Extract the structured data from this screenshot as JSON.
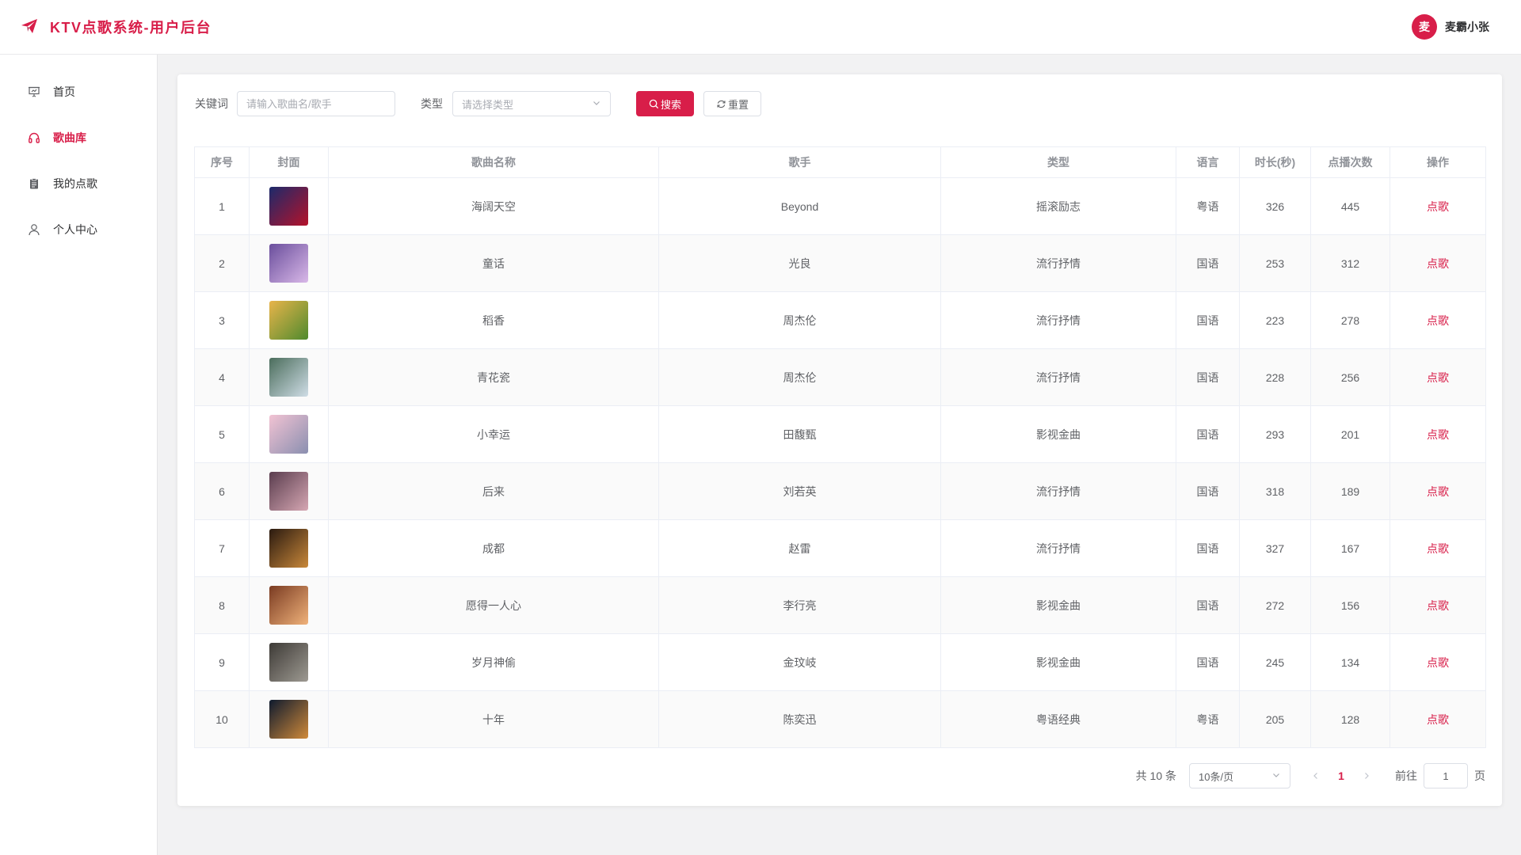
{
  "app": {
    "title": "KTV点歌系统-用户后台"
  },
  "user": {
    "avatar_text": "麦",
    "name": "麦霸小张"
  },
  "sidebar": {
    "items": [
      {
        "label": "首页",
        "icon": "presentation-icon"
      },
      {
        "label": "歌曲库",
        "icon": "headphones-icon",
        "active": true
      },
      {
        "label": "我的点歌",
        "icon": "clipboard-icon"
      },
      {
        "label": "个人中心",
        "icon": "user-icon"
      }
    ]
  },
  "search": {
    "keyword_label": "关键词",
    "keyword_placeholder": "请输入歌曲名/歌手",
    "type_label": "类型",
    "type_placeholder": "请选择类型",
    "search_button": "搜索",
    "reset_button": "重置"
  },
  "table": {
    "columns": [
      "序号",
      "封面",
      "歌曲名称",
      "歌手",
      "类型",
      "语言",
      "时长(秒)",
      "点播次数",
      "操作"
    ],
    "rows": [
      {
        "index": "1",
        "name": "海阔天空",
        "singer": "Beyond",
        "type": "摇滚励志",
        "language": "粤语",
        "duration": "326",
        "plays": "445",
        "action": "点歌",
        "cover_colors": [
          "#1c2a6b",
          "#b5122a"
        ]
      },
      {
        "index": "2",
        "name": "童话",
        "singer": "光良",
        "type": "流行抒情",
        "language": "国语",
        "duration": "253",
        "plays": "312",
        "action": "点歌",
        "cover_colors": [
          "#6a4e9c",
          "#d9b8e8"
        ]
      },
      {
        "index": "3",
        "name": "稻香",
        "singer": "周杰伦",
        "type": "流行抒情",
        "language": "国语",
        "duration": "223",
        "plays": "278",
        "action": "点歌",
        "cover_colors": [
          "#e8b44a",
          "#4f8a2e"
        ]
      },
      {
        "index": "4",
        "name": "青花瓷",
        "singer": "周杰伦",
        "type": "流行抒情",
        "language": "国语",
        "duration": "228",
        "plays": "256",
        "action": "点歌",
        "cover_colors": [
          "#4b6d5c",
          "#cfdde6"
        ]
      },
      {
        "index": "5",
        "name": "小幸运",
        "singer": "田馥甄",
        "type": "影视金曲",
        "language": "国语",
        "duration": "293",
        "plays": "201",
        "action": "点歌",
        "cover_colors": [
          "#f2c3d3",
          "#8a8fb0"
        ]
      },
      {
        "index": "6",
        "name": "后来",
        "singer": "刘若英",
        "type": "流行抒情",
        "language": "国语",
        "duration": "318",
        "plays": "189",
        "action": "点歌",
        "cover_colors": [
          "#5a3d4e",
          "#d6a7b3"
        ]
      },
      {
        "index": "7",
        "name": "成都",
        "singer": "赵雷",
        "type": "流行抒情",
        "language": "国语",
        "duration": "327",
        "plays": "167",
        "action": "点歌",
        "cover_colors": [
          "#2a1a10",
          "#c9883a"
        ]
      },
      {
        "index": "8",
        "name": "愿得一人心",
        "singer": "李行亮",
        "type": "影视金曲",
        "language": "国语",
        "duration": "272",
        "plays": "156",
        "action": "点歌",
        "cover_colors": [
          "#7a3b22",
          "#f0b27a"
        ]
      },
      {
        "index": "9",
        "name": "岁月神偷",
        "singer": "金玟岐",
        "type": "影视金曲",
        "language": "国语",
        "duration": "245",
        "plays": "134",
        "action": "点歌",
        "cover_colors": [
          "#3d3a36",
          "#9e9a92"
        ]
      },
      {
        "index": "10",
        "name": "十年",
        "singer": "陈奕迅",
        "type": "粤语经典",
        "language": "粤语",
        "duration": "205",
        "plays": "128",
        "action": "点歌",
        "cover_colors": [
          "#0e1a2e",
          "#d08a3a"
        ]
      }
    ]
  },
  "pagination": {
    "total_text": "共 10 条",
    "page_size": "10条/页",
    "current_page": "1",
    "goto_label": "前往",
    "goto_value": "1",
    "page_suffix": "页"
  },
  "colors": {
    "accent": "#d81e49"
  }
}
